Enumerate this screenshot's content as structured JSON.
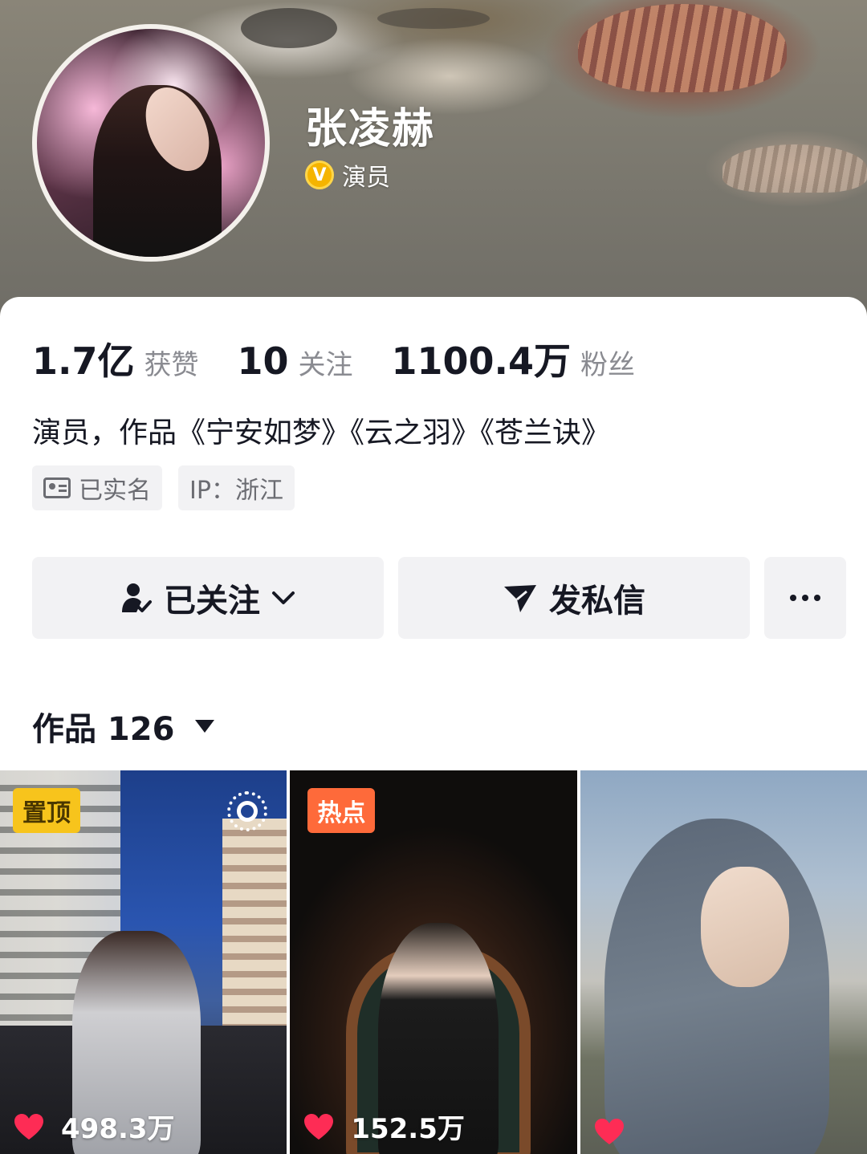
{
  "profile": {
    "name": "张凌赫",
    "verify_label": "演员",
    "bio": "演员，作品《宁安如梦》《云之羽》《苍兰诀》"
  },
  "stats": [
    {
      "value": "1.7亿",
      "label": "获赞"
    },
    {
      "value": "10",
      "label": "关注"
    },
    {
      "value": "1100.4万",
      "label": "粉丝"
    }
  ],
  "tags": {
    "realname": "已实名",
    "ip": "IP：浙江"
  },
  "actions": {
    "follow_label": "已关注",
    "message_label": "发私信"
  },
  "works": {
    "title": "作品 126"
  },
  "videos": [
    {
      "badge": "置顶",
      "likes": "498.3万"
    },
    {
      "badge": "热点",
      "likes": "152.5万"
    },
    {
      "badge": "",
      "likes": ""
    }
  ],
  "colors": {
    "pin_badge": "#f7c41c",
    "hot_badge": "#fe6a3a",
    "heart": "#fe2c55",
    "verify": "#f5b400"
  }
}
